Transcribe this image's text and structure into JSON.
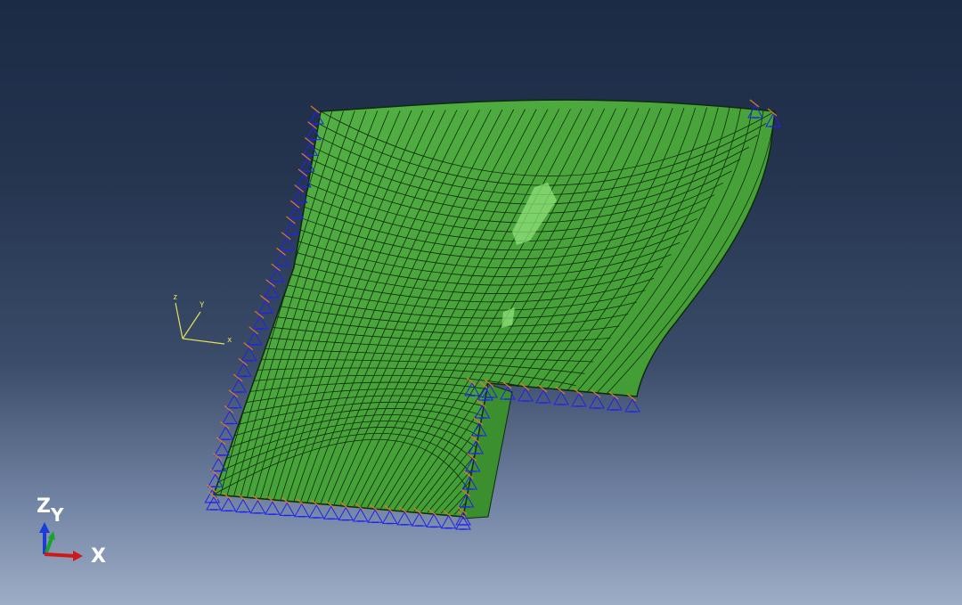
{
  "viewport": {
    "background_top": "#1b2a45",
    "background_bottom": "#9eadc6",
    "mesh_color": "#4aa63b",
    "mesh_highlight": "#8fe07a",
    "mesh_line_color": "#0f2a0c",
    "bc_primary_color": "#2222ee",
    "bc_secondary_color": "#e07a20"
  },
  "triad": {
    "z_label": "Z",
    "y_label": "Y",
    "x_label": "X",
    "z_color": "#1b3cd6",
    "y_color": "#18a32a",
    "x_color": "#d01818"
  },
  "csys": {
    "z_label": "z",
    "y_label": "Y",
    "x_label": "x",
    "color": "#e6e05a"
  }
}
